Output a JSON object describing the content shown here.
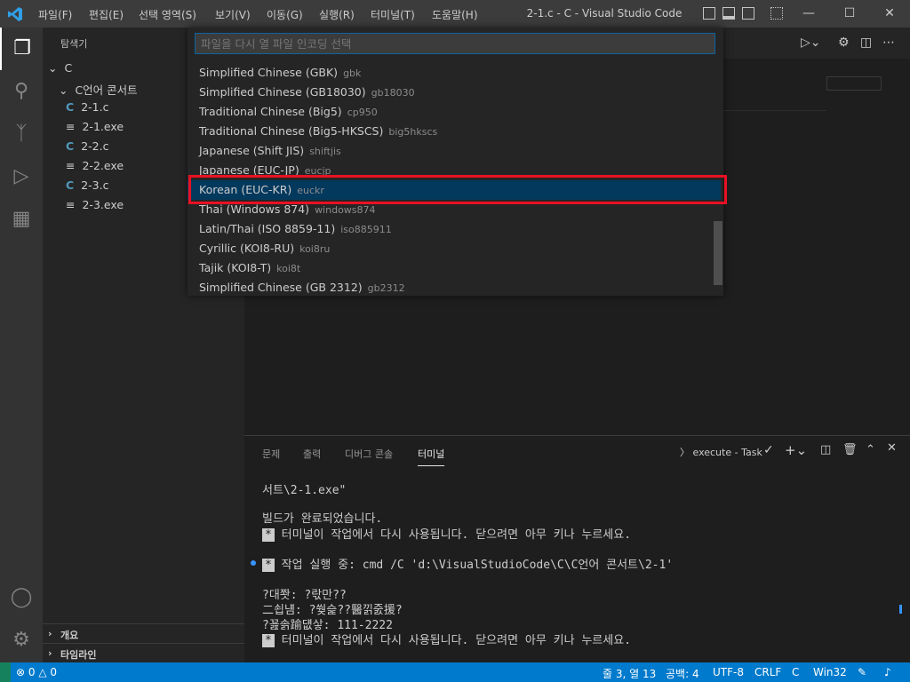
{
  "titlebar": {
    "menu": [
      "파일(F)",
      "편집(E)",
      "선택 영역(S)",
      "보기(V)",
      "이동(G)",
      "실행(R)",
      "터미널(T)",
      "도움말(H)"
    ],
    "title": "2-1.c - C - Visual Studio Code",
    "window_controls": [
      "minimize-icon",
      "maximize-icon",
      "close-icon"
    ]
  },
  "activitybar": {
    "icons": [
      "explorer-icon",
      "search-icon",
      "source-control-icon",
      "run-debug-icon",
      "extensions-icon",
      "account-icon",
      "settings-gear-icon"
    ]
  },
  "sidebar": {
    "title": "탐색기",
    "root": "C",
    "folder": "C언어 콘서트",
    "files": [
      {
        "name": "2-1.c",
        "type": "c"
      },
      {
        "name": "2-1.exe",
        "type": "exe"
      },
      {
        "name": "2-2.c",
        "type": "c"
      },
      {
        "name": "2-2.exe",
        "type": "exe"
      },
      {
        "name": "2-3.c",
        "type": "c"
      },
      {
        "name": "2-3.exe",
        "type": "exe"
      }
    ],
    "outline": "개요",
    "timeline": "타임라인"
  },
  "quickpick": {
    "placeholder": "파일을 다시 열 파일 인코딩 선택",
    "items": [
      {
        "label": "Simplified Chinese (GBK)",
        "desc": "gbk"
      },
      {
        "label": "Simplified Chinese (GB18030)",
        "desc": "gb18030"
      },
      {
        "label": "Traditional Chinese (Big5)",
        "desc": "cp950"
      },
      {
        "label": "Traditional Chinese (Big5-HKSCS)",
        "desc": "big5hkscs"
      },
      {
        "label": "Japanese (Shift JIS)",
        "desc": "shiftjis"
      },
      {
        "label": "Japanese (EUC-JP)",
        "desc": "eucjp"
      },
      {
        "label": "Korean (EUC-KR)",
        "desc": "euckr"
      },
      {
        "label": "Thai (Windows 874)",
        "desc": "windows874"
      },
      {
        "label": "Latin/Thai (ISO 8859-11)",
        "desc": "iso885911"
      },
      {
        "label": "Cyrillic (KOI8-RU)",
        "desc": "koi8ru"
      },
      {
        "label": "Tajik (KOI8-T)",
        "desc": "koi8t"
      },
      {
        "label": "Simplified Chinese (GB 2312)",
        "desc": "gb2312"
      }
    ],
    "selected_index": 6
  },
  "panel": {
    "tabs": [
      "문제",
      "출력",
      "디버그 콘솔",
      "터미널"
    ],
    "active_tab": "터미널",
    "task_label": "execute - Task",
    "terminal_lines": [
      "서트\\2-1.exe\"",
      "",
      "빌드가 완료되었습니다.",
      "터미널이 작업에서 다시 사용됩니다. 닫으려면 아무 키나 누르세요.",
      "",
      "작업 실행 중: cmd /C 'd:\\VisualStudioCode\\C\\C언어 콘서트\\2-1'",
      "",
      "?대쫫: ?띿만??",
      "二쇱냼: ?쒖슱??醫낅줈援?",
      "?꾪솕踰덊샇: 111-2222",
      "터미널이 작업에서 다시 사용됩니다. 닫으려면 아무 키나 누르세요."
    ]
  },
  "statusbar": {
    "errors": "0",
    "warnings": "0",
    "position": "줄 3, 열 13",
    "spaces": "공백: 4",
    "encoding": "UTF-8",
    "eol": "CRLF",
    "language": "C",
    "platform": "Win32"
  },
  "colors": {
    "accent": "#007acc",
    "highlight_border": "#e81123",
    "focused_row": "#04395e"
  }
}
